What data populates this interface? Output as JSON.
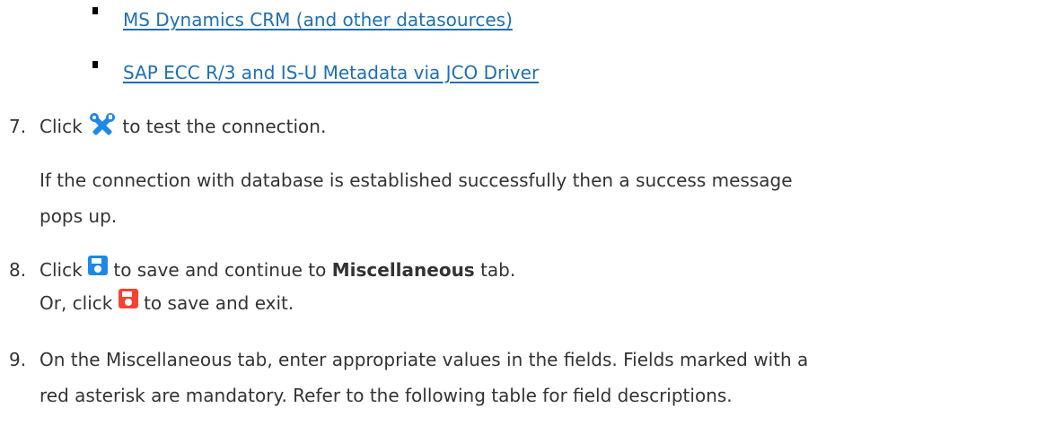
{
  "links": [
    "MS Dynamics CRM (and other datasources)",
    "SAP ECC R/3 and IS-U Metadata via JCO Driver"
  ],
  "step7": {
    "number": "7.",
    "before_icon": "Click",
    "icon": "tools-icon",
    "after_icon": "to test the connection.",
    "note_line1": "If the connection with database is established successfully then a success message",
    "note_line2": "pops up."
  },
  "step8": {
    "number": "8.",
    "before_icon": "Click",
    "icon": "save-icon",
    "icon_color": "#1e88e5",
    "after_icon": "to save and continue to",
    "tab_name": "Miscellaneous",
    "after_tab": "tab.",
    "or_text": "Or, click",
    "exit_icon": "save-exit-icon",
    "exit_icon_color": "#f44336",
    "after_exit": "to save and exit."
  },
  "step9": {
    "number": "9.",
    "line1": "On the Miscellaneous tab, enter appropriate values in the fields. Fields marked with a",
    "line2": "red asterisk are mandatory. Refer to the following table for field descriptions."
  },
  "colors": {
    "link": "#1f6fb2",
    "text": "#333333"
  }
}
